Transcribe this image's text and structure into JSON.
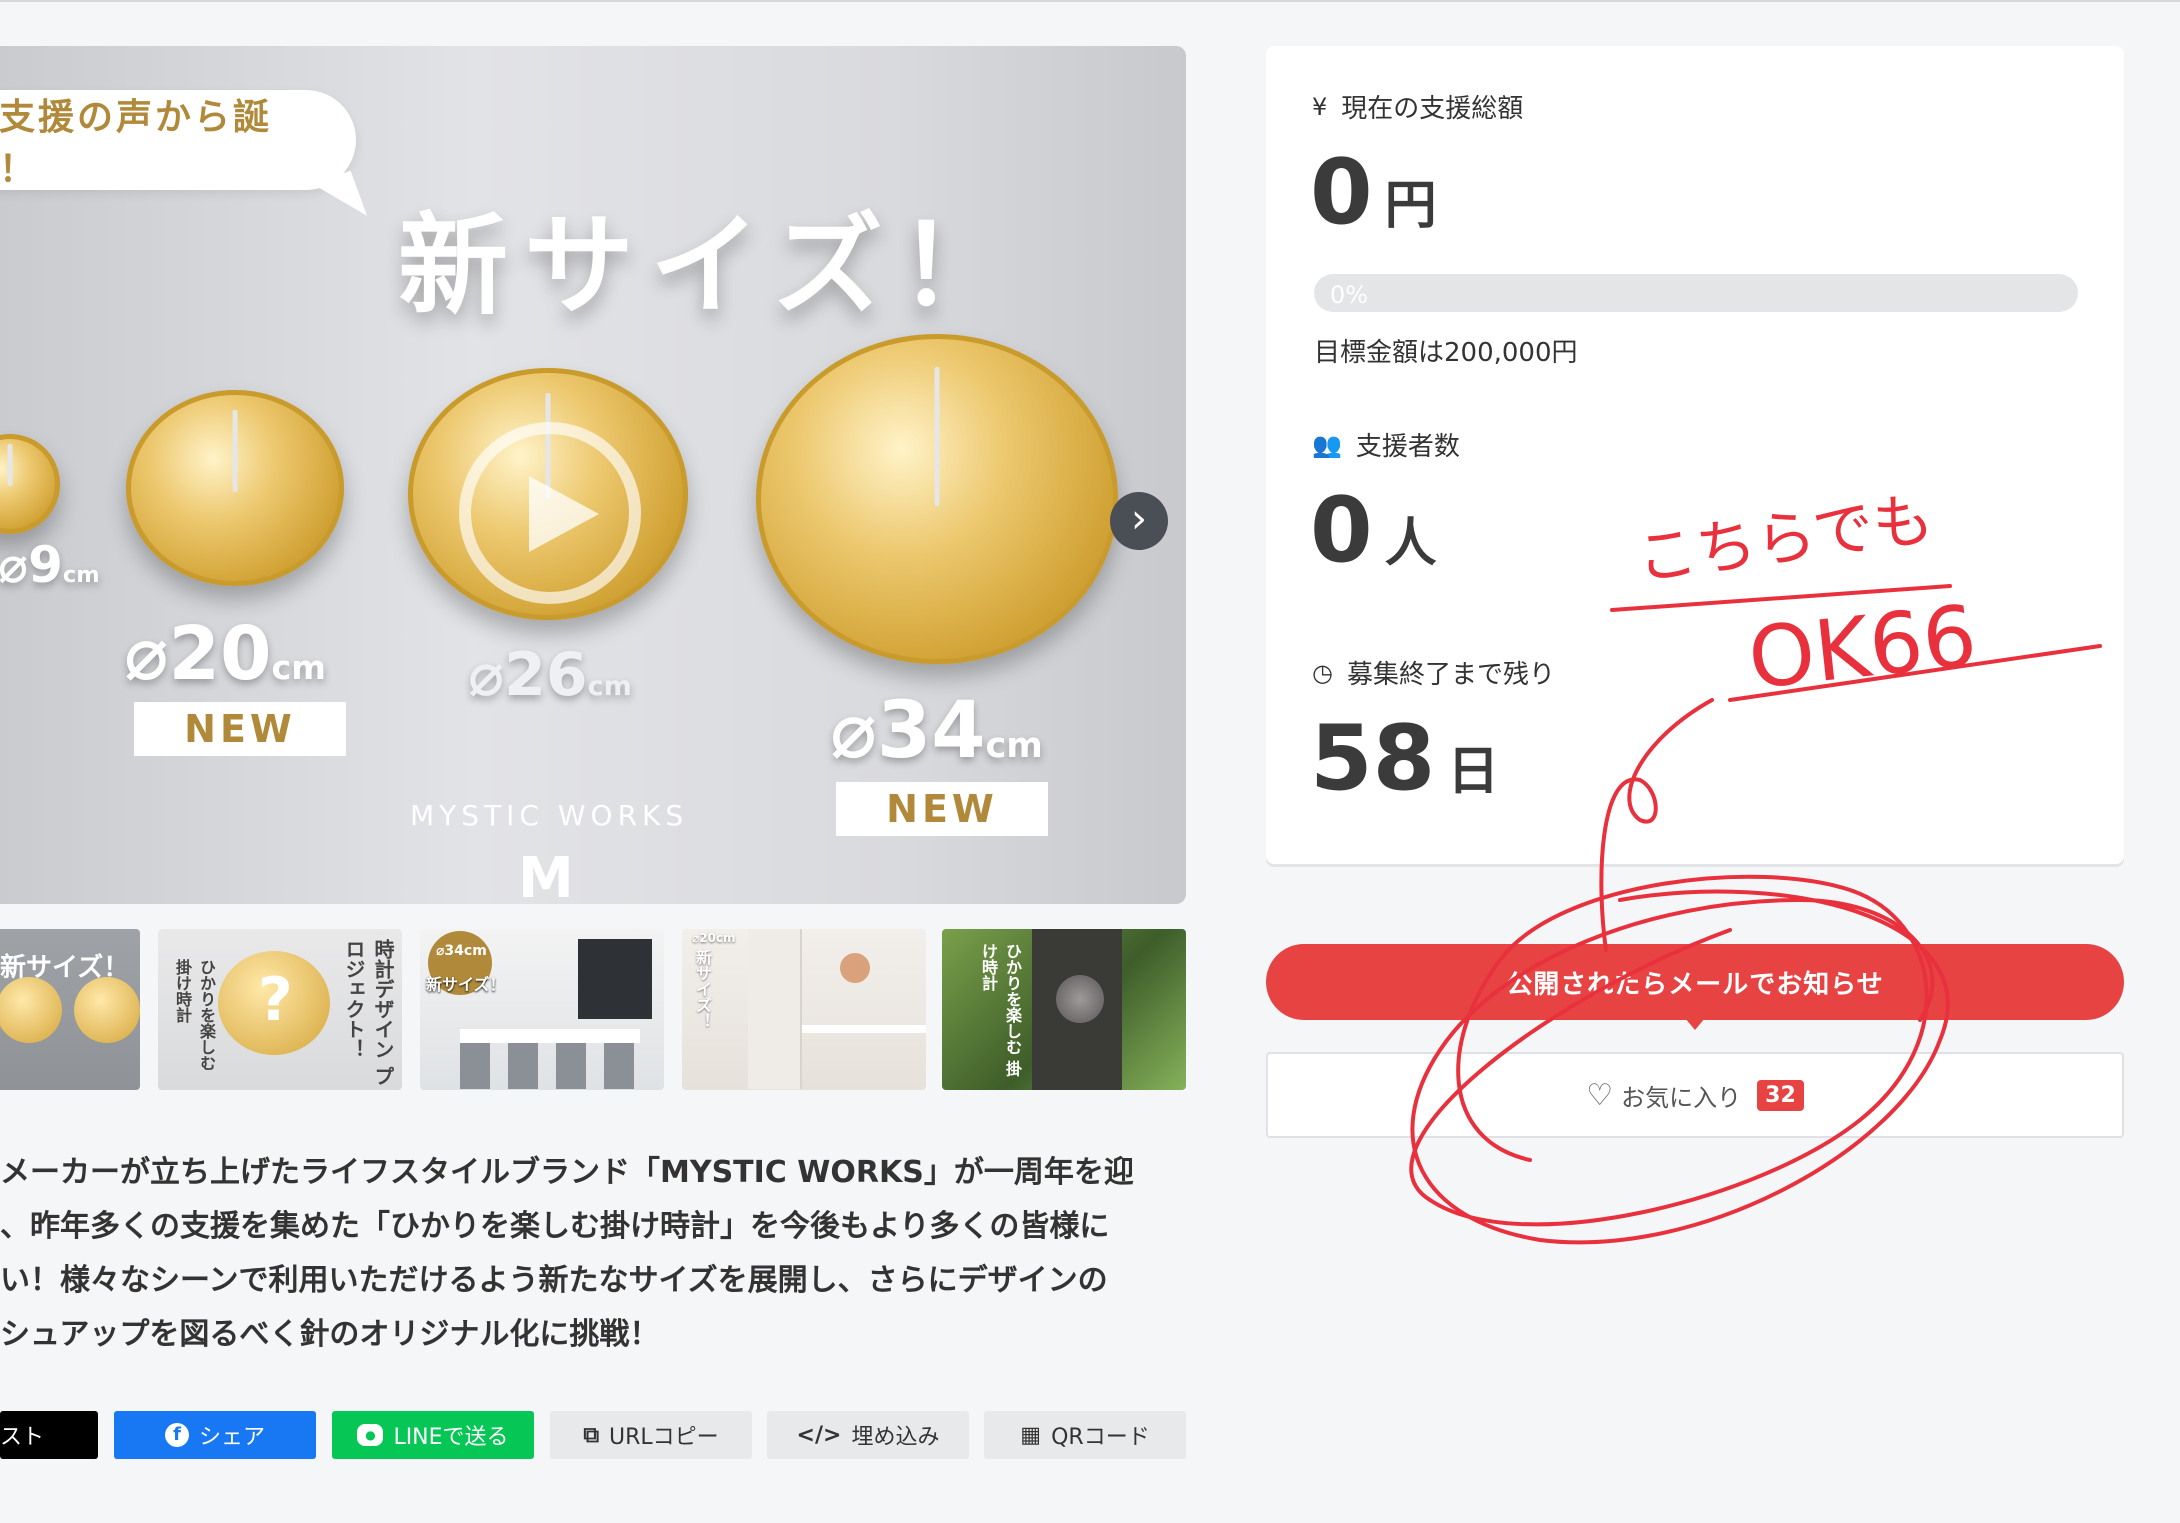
{
  "hero": {
    "bubble_text": "ご支援の声から誕生！",
    "headline": "新サイズ！",
    "sizes": [
      {
        "diameter": "⌀9",
        "unit": "cm"
      },
      {
        "diameter": "⌀20",
        "unit": "cm",
        "badge": "NEW"
      },
      {
        "diameter": "⌀26",
        "unit": "cm"
      },
      {
        "diameter": "⌀34",
        "unit": "cm",
        "badge": "NEW"
      }
    ],
    "brand": "MYSTIC WORKS",
    "brandmark": "M",
    "next_icon": "›"
  },
  "thumbnails": [
    {
      "caption": "新サイズ！"
    },
    {
      "caption": "時計デザイン プロジェクト！",
      "sub": "ひかりを楽しむ 掛け時計"
    },
    {
      "caption": "新サイズ！",
      "badge": "⌀34cm"
    },
    {
      "caption": "新サイズ！",
      "badge": "⌀20cm"
    },
    {
      "caption": "ひかりを楽しむ 掛け時計"
    }
  ],
  "description": [
    "メーカーが立ち上げたライフスタイルブランド「MYSTIC WORKS」が一周年を迎",
    "、昨年多くの支援を集めた「ひかりを楽しむ掛け時計」を今後もより多くの皆様に",
    "い！様々なシーンで利用いただけるよう新たなサイズを展開し、さらにデザインの",
    "シュアップを図るべく針のオリジナル化に挑戦！"
  ],
  "share": {
    "post": "スト",
    "facebook": "シェア",
    "line": "LINEで送る",
    "url": "URLコピー",
    "embed": "埋め込み",
    "qr": "QRコード"
  },
  "stats": {
    "total_label": "現在の支援総額",
    "total_value": "0",
    "total_unit": "円",
    "progress_text": "0%",
    "progress": 0,
    "goal_text": "目標金額は200,000円",
    "backers_label": "支援者数",
    "backers_value": "0",
    "backers_unit": "人",
    "remaining_label": "募集終了まで残り",
    "remaining_value": "58",
    "remaining_unit": "日"
  },
  "actions": {
    "notify_label": "公開されたらメールでお知らせ",
    "favorite_label": "お気に入り",
    "favorite_count": "32"
  },
  "annotation": {
    "line1": "こちらでも",
    "line2": "OK66"
  },
  "colors": {
    "accent_red": "#e84343",
    "facebook_blue": "#1877f2",
    "line_green": "#06c755",
    "annotation_red": "#e8313c"
  }
}
